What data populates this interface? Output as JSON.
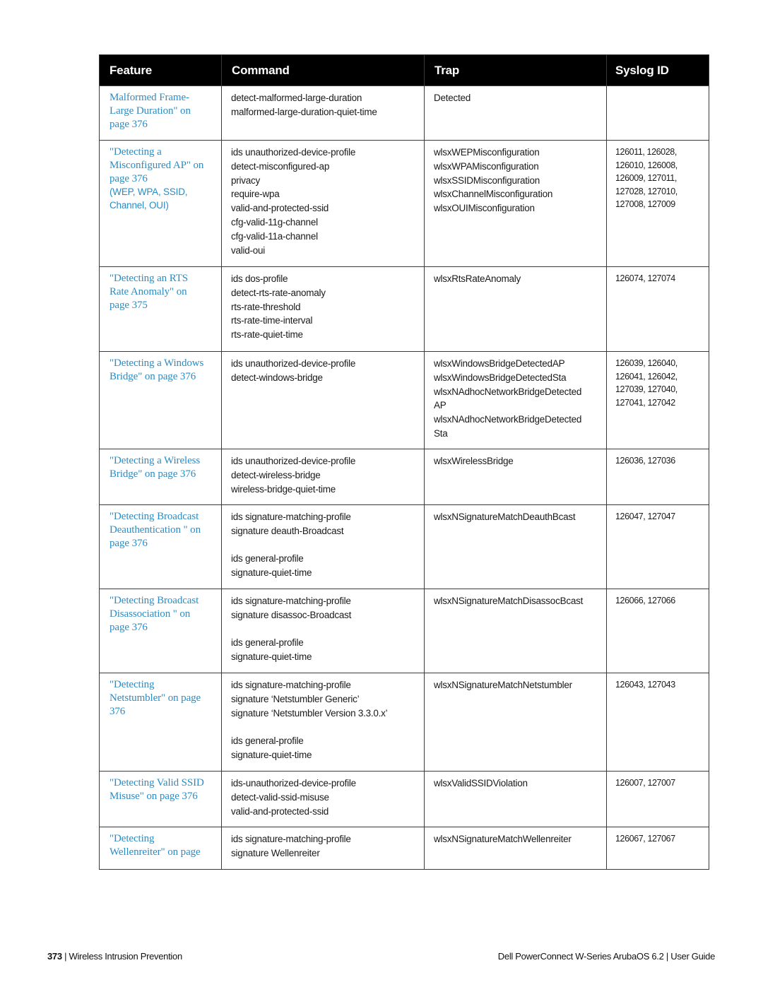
{
  "table": {
    "headers": {
      "feature": "Feature",
      "command": "Command",
      "trap": "Trap",
      "syslog": "Syslog ID"
    },
    "rows": [
      {
        "feature_lines": [
          "Malformed Frame-",
          "Large Duration\" on",
          "page 376"
        ],
        "feature_sub": [],
        "command": [
          "detect-malformed-large-duration",
          "malformed-large-duration-quiet-time"
        ],
        "trap": [
          "Detected"
        ],
        "syslog": [],
        "height": 77
      },
      {
        "feature_lines": [
          "\"Detecting a",
          "Misconfigured AP\" on",
          "page 376"
        ],
        "feature_sub": [
          "(WEP, WPA, SSID,",
          "Channel, OUI)"
        ],
        "command": [
          "ids unauthorized-device-profile",
          "detect-misconfigured-ap",
          "privacy",
          "require-wpa",
          "valid-and-protected-ssid",
          "cfg-valid-11g-channel",
          "cfg-valid-11a-channel",
          "valid-oui"
        ],
        "trap": [
          "wlsxWEPMisconfiguration",
          "wlsxWPAMisconfiguration",
          "wlsxSSIDMisconfiguration",
          "wlsxChannelMisconfiguration",
          "wlsxOUIMisconfiguration"
        ],
        "syslog": [
          "126011, 126028,",
          "126010, 126008,",
          "126009, 127011,",
          "127028, 127010,",
          "127008, 127009"
        ],
        "height": 179
      },
      {
        "feature_lines": [
          "\"Detecting an RTS",
          "Rate Anomaly\" on",
          "page 375"
        ],
        "feature_sub": [],
        "command": [
          "ids dos-profile",
          "detect-rts-rate-anomaly",
          "rts-rate-threshold",
          "rts-rate-time-interval",
          "rts-rate-quiet-time"
        ],
        "trap": [
          "wlsxRtsRateAnomaly"
        ],
        "syslog": [
          "126074, 127074"
        ],
        "height": 120
      },
      {
        "feature_lines": [
          "\"Detecting a Windows",
          "Bridge\" on page 376"
        ],
        "feature_sub": [],
        "command": [
          "ids unauthorized-device-profile",
          "detect-windows-bridge"
        ],
        "trap": [
          "wlsxWindowsBridgeDetectedAP",
          "wlsxWindowsBridgeDetectedSta",
          "wlsxNAdhocNetworkBridgeDetected",
          "AP",
          "wlsxNAdhocNetworkBridgeDetected",
          "Sta"
        ],
        "syslog": [
          "126039, 126040,",
          "126041, 126042,",
          "127039, 127040,",
          "127041, 127042"
        ],
        "height": 138
      },
      {
        "feature_lines": [
          "\"Detecting a Wireless",
          "Bridge\" on page 376"
        ],
        "feature_sub": [],
        "command": [
          "ids unauthorized-device-profile",
          "detect-wireless-bridge",
          "wireless-bridge-quiet-time"
        ],
        "trap": [
          "wlsxWirelessBridge"
        ],
        "syslog": [
          "126036, 127036"
        ],
        "height": 79
      },
      {
        "feature_lines": [
          "\"Detecting Broadcast",
          "Deauthentication \" on",
          "page 376"
        ],
        "feature_sub": [],
        "command": [
          "ids signature-matching-profile",
          "signature deauth-Broadcast",
          "",
          "ids general-profile",
          "signature-quiet-time"
        ],
        "trap": [
          "wlsxNSignatureMatchDeauthBcast"
        ],
        "syslog": [
          "126047, 127047"
        ],
        "height": 119
      },
      {
        "feature_lines": [
          "\"Detecting Broadcast",
          "Disassociation \" on",
          "page 376"
        ],
        "feature_sub": [],
        "command": [
          "ids signature-matching-profile",
          "signature disassoc-Broadcast",
          "",
          "ids general-profile",
          "signature-quiet-time"
        ],
        "trap": [
          "wlsxNSignatureMatchDisassocBcast"
        ],
        "syslog": [
          "126066, 127066"
        ],
        "height": 119
      },
      {
        "feature_lines": [
          "\"Detecting",
          "Netstumbler\" on page",
          "376"
        ],
        "feature_sub": [],
        "command": [
          "ids signature-matching-profile",
          "signature ‘Netstumbler Generic’",
          "signature ‘Netstumbler Version 3.3.0.x’",
          "",
          "ids general-profile",
          "signature-quiet-time"
        ],
        "trap": [
          "wlsxNSignatureMatchNetstumbler"
        ],
        "syslog": [
          "126043, 127043"
        ],
        "height": 139
      },
      {
        "feature_lines": [
          "\"Detecting Valid SSID",
          "Misuse\" on page 376"
        ],
        "feature_sub": [],
        "command": [
          "ids-unauthorized-device-profile",
          "detect-valid-ssid-misuse",
          "valid-and-protected-ssid"
        ],
        "trap": [
          "wlsxValidSSIDViolation"
        ],
        "syslog": [
          "126007, 127007"
        ],
        "height": 79
      },
      {
        "feature_lines": [
          "\"Detecting",
          "Wellenreiter\" on page"
        ],
        "feature_sub": [],
        "command": [
          "ids signature-matching-profile",
          "signature Wellenreiter"
        ],
        "trap": [
          "wlsxNSignatureMatchWellenreiter"
        ],
        "syslog": [
          "126067, 127067"
        ],
        "height": 60
      }
    ]
  },
  "footer": {
    "page_number": "373",
    "separator": " | ",
    "section": "Wireless Intrusion Prevention",
    "guide_title": "Dell PowerConnect W-Series ArubaOS 6.2  |  User Guide"
  },
  "colors": {
    "header_bg": "#000000",
    "header_text": "#ffffff",
    "link": "#2a8cc4",
    "border": "#3a3a3a"
  }
}
